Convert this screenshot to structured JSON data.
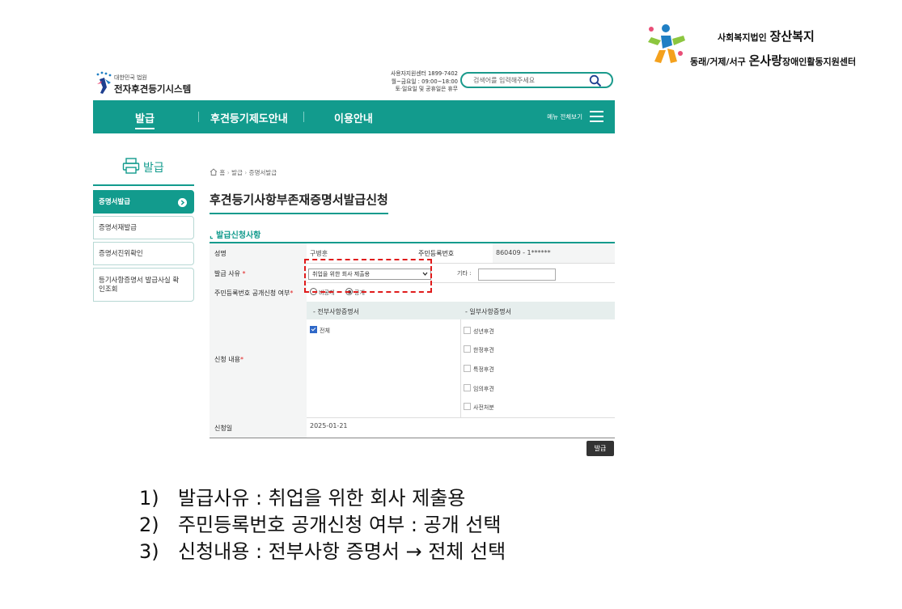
{
  "org_logo": {
    "line1_small": "사회복지법인",
    "line1_big": "장산복지",
    "line2_small": "동래/거제/서구",
    "line2_big": "온사랑",
    "line2_suffix": "장애인활동지원센터"
  },
  "site": {
    "logo_top": "대한민국 법원",
    "logo_name": "전자후견등기시스템",
    "contact_lines": [
      "사용자지원센터 1899-7402",
      "월~금요일 : 09:00~18:00",
      "토·일요일 및 공휴일은 휴무"
    ],
    "search_placeholder": "검색어를 입력해주세요"
  },
  "nav": {
    "tabs": [
      "발급",
      "후견등기제도안내",
      "이용안내"
    ],
    "active_tab": "발급",
    "menu_all": "메뉴 전체보기"
  },
  "sidebar": {
    "heading": "발급",
    "items": [
      "증명서발급",
      "증명서재발급",
      "증명서진위확인",
      "등기사항증명서 발급사실 확인조회"
    ],
    "active_item": "증명서발급"
  },
  "breadcrumb": [
    "홈",
    "발급",
    "증명서발급"
  ],
  "page_title": "후견등기사항부존재증명서발급신청",
  "section_title": "발급신청사항",
  "form": {
    "name_label": "성명",
    "name_value": "구병훈",
    "rrn_label": "주민등록번호",
    "rrn_value": "860409 - 1******",
    "reason_label": "발급 사유",
    "reason_value": "취업을 위한 회사 제출용",
    "etc_label": "기타 :",
    "disclose_label": "주민등록번호 공개신청 여부",
    "disclose_options": [
      "비공개",
      "공개"
    ],
    "disclose_selected": "공개",
    "content_label": "신청 내용",
    "full_header": "- 전부사항증명서",
    "partial_header": "- 일부사항증명서",
    "full_options": [
      "전체"
    ],
    "full_checked": [
      "전체"
    ],
    "partial_options": [
      "성년후견",
      "한정후견",
      "특정후견",
      "임의후견",
      "사전처분"
    ],
    "date_label": "신청일",
    "date_value": "2025-01-21",
    "required_mark": "*"
  },
  "issue_button": "발급",
  "notes": [
    {
      "num": "1)",
      "text": "발급사유 : 취업을 위한 회사 제출용"
    },
    {
      "num": "2)",
      "text": "주민등록번호 공개신청 여부 : 공개 선택"
    },
    {
      "num": "3)",
      "text": "신청내용 : 전부사항 증명서 → 전체 선택"
    }
  ],
  "colors": {
    "accent": "#129b8d",
    "required": "#e02020",
    "highlight": "#e01b1b"
  }
}
